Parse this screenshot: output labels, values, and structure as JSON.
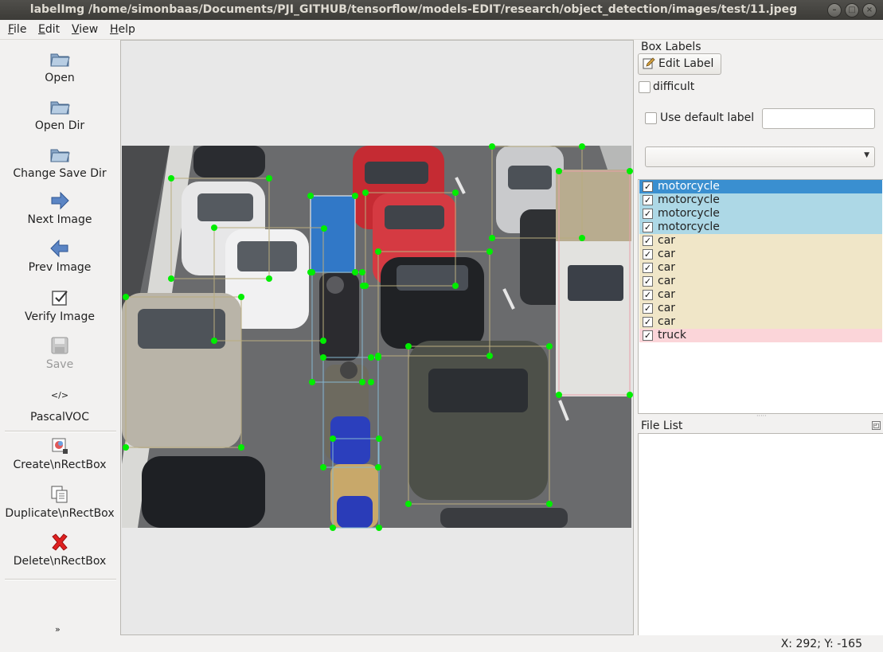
{
  "window": {
    "title": "labelImg /home/simonbaas/Documents/PJI_GITHUB/tensorflow/models-EDIT/research/object_detection/images/test/11.jpeg"
  },
  "menu": [
    {
      "label": "File",
      "u": "F",
      "rest": "ile"
    },
    {
      "label": "Edit",
      "u": "E",
      "rest": "dit"
    },
    {
      "label": "View",
      "u": "V",
      "rest": "iew"
    },
    {
      "label": "Help",
      "u": "H",
      "rest": "elp"
    }
  ],
  "toolbar": {
    "open": "Open",
    "open_dir": "Open Dir",
    "change_save_dir": "Change Save Dir",
    "next_image": "Next Image",
    "prev_image": "Prev Image",
    "verify_image": "Verify Image",
    "save": "Save",
    "format_code": "</>",
    "format": "PascalVOC",
    "create": "Create\\nRectBox",
    "duplicate": "Duplicate\\nRectBox",
    "delete": "Delete\\nRectBox"
  },
  "box_labels": {
    "title": "Box Labels",
    "edit_label": "Edit Label",
    "difficult": "difficult",
    "use_default_label": "Use default label",
    "default_label_value": "",
    "combo_value": ""
  },
  "labels": [
    {
      "name": "motorcycle",
      "selected": true,
      "color": "#3a8fd0"
    },
    {
      "name": "motorcycle",
      "selected": false,
      "color": "#add8e6"
    },
    {
      "name": "motorcycle",
      "selected": false,
      "color": "#add8e6"
    },
    {
      "name": "motorcycle",
      "selected": false,
      "color": "#add8e6"
    },
    {
      "name": "car",
      "selected": false,
      "color": "#f0e6c8"
    },
    {
      "name": "car",
      "selected": false,
      "color": "#f0e6c8"
    },
    {
      "name": "car",
      "selected": false,
      "color": "#f0e6c8"
    },
    {
      "name": "car",
      "selected": false,
      "color": "#f0e6c8"
    },
    {
      "name": "car",
      "selected": false,
      "color": "#f0e6c8"
    },
    {
      "name": "car",
      "selected": false,
      "color": "#f0e6c8"
    },
    {
      "name": "car",
      "selected": false,
      "color": "#f0e6c8"
    },
    {
      "name": "truck",
      "selected": false,
      "color": "#fbd5d9"
    }
  ],
  "file_list": {
    "title": "File List"
  },
  "status": {
    "coords": "X: 292; Y: -165"
  },
  "colors": {
    "accent": "#3a8fd0",
    "handle": "#00ee00"
  }
}
